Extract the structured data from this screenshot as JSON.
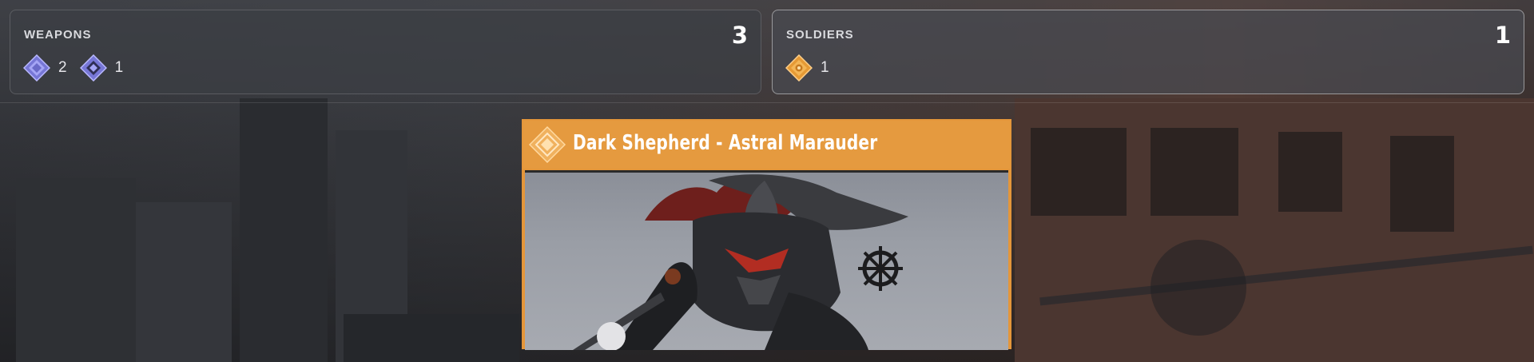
{
  "weapons": {
    "title": "WEAPONS",
    "count": "3",
    "items": [
      {
        "icon": "legendary-weapon-icon",
        "count": "2",
        "color": "#8f8ff0"
      },
      {
        "icon": "rare-weapon-icon",
        "count": "1",
        "color": "#8f8ff0"
      }
    ]
  },
  "soldiers": {
    "title": "SOLDIERS",
    "count": "1",
    "items": [
      {
        "icon": "exotic-soldier-icon",
        "count": "1",
        "color": "#f0a43a"
      }
    ]
  },
  "reward_card": {
    "title": "Dark Shepherd - Astral Marauder",
    "emblem": "exotic-emblem-icon",
    "accent_color": "#e59a3f",
    "art": "masked-pirate-soldier-portrait"
  }
}
